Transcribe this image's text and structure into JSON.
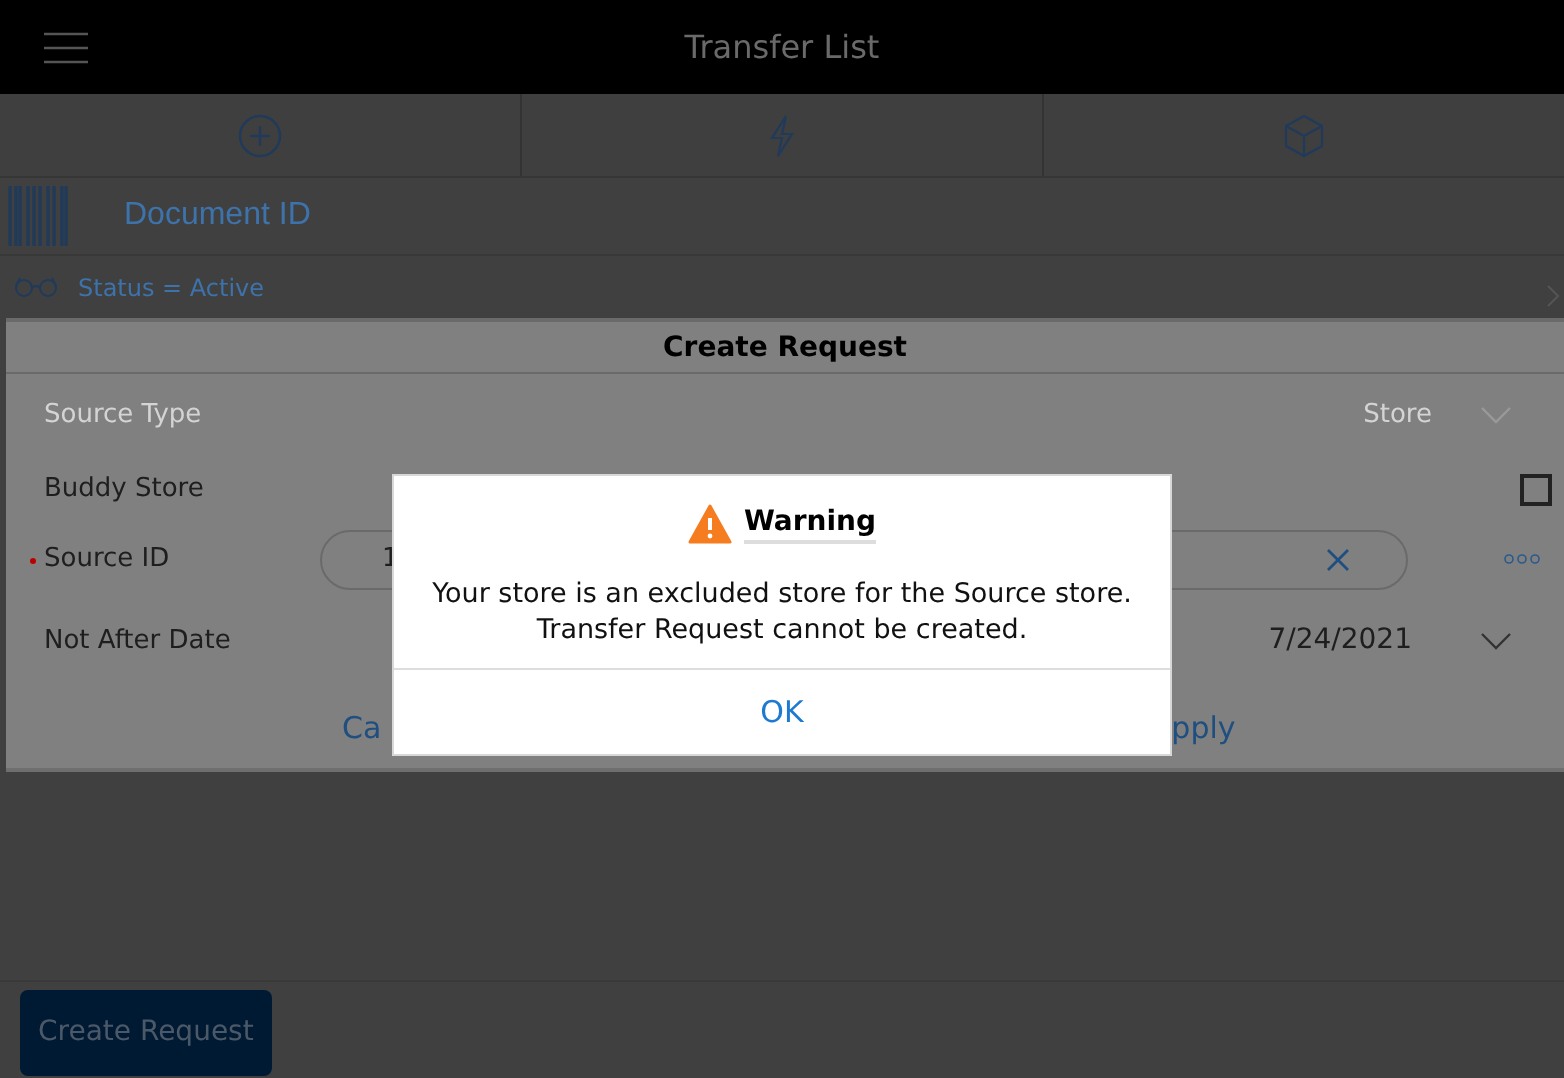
{
  "top_bar": {
    "title": "Transfer List"
  },
  "toolbar": {
    "actions": [
      {
        "kind": "add"
      },
      {
        "kind": "flash"
      },
      {
        "kind": "box"
      }
    ]
  },
  "document_field": {
    "placeholder": "Document ID"
  },
  "filter": {
    "label": "Status = Active"
  },
  "panel": {
    "title": "Create Request",
    "rows": [
      {
        "kind": "select",
        "label": "Source Type",
        "value": "Store",
        "disabled": true,
        "required": false
      },
      {
        "kind": "checkbox",
        "label": "Buddy Store",
        "checked": false,
        "disabled": false,
        "required": false
      },
      {
        "kind": "input",
        "label": "Source ID",
        "value": "1",
        "disabled": false,
        "required": true
      },
      {
        "kind": "date",
        "label": "Not After Date",
        "value": "7/24/2021",
        "disabled": false,
        "required": false
      }
    ],
    "buttons": [
      "Ca",
      "pply"
    ]
  },
  "dialog": {
    "title": "Warning",
    "message": [
      "Your store is an excluded store for the Source store.",
      "Transfer Request cannot be created."
    ],
    "button": "OK"
  },
  "bottom_bar": {
    "button": "Create Request"
  }
}
